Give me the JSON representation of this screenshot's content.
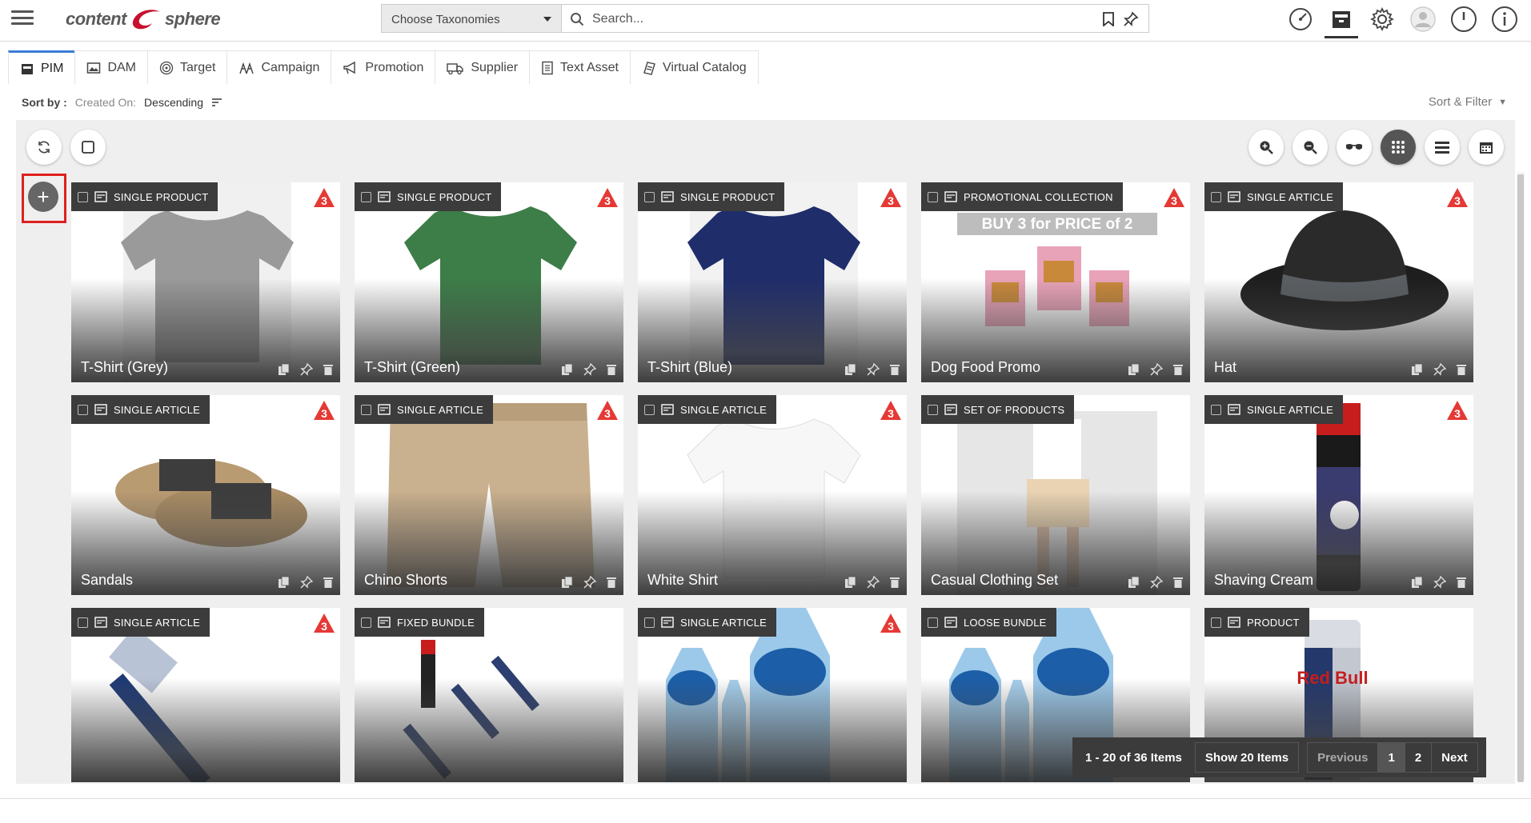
{
  "logo": {
    "left": "content",
    "right": "sphere"
  },
  "header": {
    "taxonomy_select": "Choose Taxonomies",
    "search_placeholder": "Search..."
  },
  "tabs": [
    {
      "label": "PIM",
      "icon": "box-icon",
      "active": true
    },
    {
      "label": "DAM",
      "icon": "image-icon"
    },
    {
      "label": "Target",
      "icon": "target-icon"
    },
    {
      "label": "Campaign",
      "icon": "campaign-icon"
    },
    {
      "label": "Promotion",
      "icon": "megaphone-icon"
    },
    {
      "label": "Supplier",
      "icon": "truck-icon"
    },
    {
      "label": "Text Asset",
      "icon": "document-icon"
    },
    {
      "label": "Virtual Catalog",
      "icon": "catalog-icon"
    }
  ],
  "sort": {
    "label": "Sort by :",
    "key": "Created On:",
    "value": "Descending",
    "filter_label": "Sort & Filter"
  },
  "cards": [
    {
      "type": "SINGLE PRODUCT",
      "name": "T-Shirt (Grey)",
      "badge": "3"
    },
    {
      "type": "SINGLE PRODUCT",
      "name": "T-Shirt (Green)",
      "badge": "3"
    },
    {
      "type": "SINGLE PRODUCT",
      "name": "T-Shirt (Blue)",
      "badge": "3"
    },
    {
      "type": "PROMOTIONAL COLLECTION",
      "name": "Dog Food Promo",
      "badge": "3",
      "banner": "BUY 3 for PRICE of 2"
    },
    {
      "type": "SINGLE ARTICLE",
      "name": "Hat",
      "badge": "3"
    },
    {
      "type": "SINGLE ARTICLE",
      "name": "Sandals",
      "badge": "3"
    },
    {
      "type": "SINGLE ARTICLE",
      "name": "Chino Shorts",
      "badge": "3"
    },
    {
      "type": "SINGLE ARTICLE",
      "name": "White Shirt",
      "badge": "3"
    },
    {
      "type": "SET OF PRODUCTS",
      "name": "Casual Clothing Set",
      "badge": ""
    },
    {
      "type": "SINGLE ARTICLE",
      "name": "Shaving Cream",
      "badge": "3"
    },
    {
      "type": "SINGLE ARTICLE",
      "name": "",
      "badge": "3"
    },
    {
      "type": "FIXED BUNDLE",
      "name": "",
      "badge": ""
    },
    {
      "type": "SINGLE ARTICLE",
      "name": "",
      "badge": "3"
    },
    {
      "type": "LOOSE BUNDLE",
      "name": "",
      "badge": ""
    },
    {
      "type": "PRODUCT",
      "name": "",
      "badge": ""
    }
  ],
  "pager": {
    "count": "1 - 20 of 36 Items",
    "show": "Show 20 Items",
    "previous": "Previous",
    "pages": [
      "1",
      "2"
    ],
    "next": "Next"
  },
  "colors": {
    "accent": "#3a7bd5",
    "warn": "#e53935",
    "badge_bg": "#3c3c3c"
  }
}
